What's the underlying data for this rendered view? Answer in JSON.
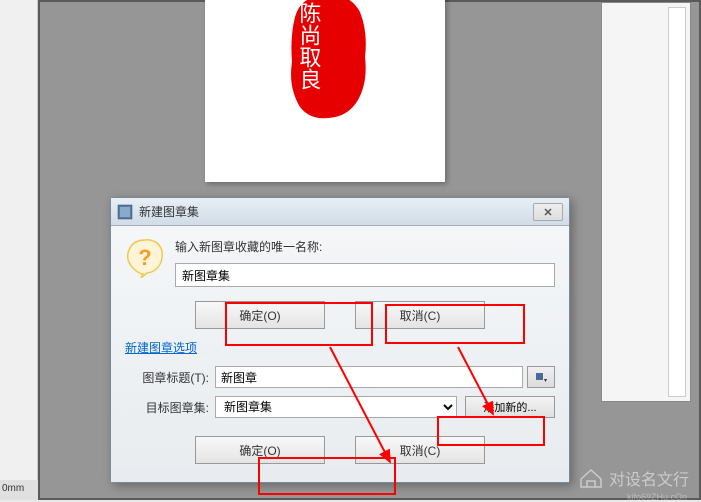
{
  "status": {
    "value": "0mm"
  },
  "dialog": {
    "title": "新建图章集",
    "prompt": "输入新图章收藏的唯一名称:",
    "name_value": "新图章集",
    "ok": "确定(O)",
    "cancel": "取消(C)",
    "section_link": "新建图章选项",
    "title_label": "图章标题(T):",
    "title_value": "新图章",
    "target_label": "目标图章集:",
    "target_value": "新图章集",
    "add_new": "添加新的...",
    "ok2": "确定(O)",
    "cancel2": "取消(C)"
  },
  "watermark": {
    "main": "对设名文行",
    "sub": "kifo69ZHu.cOn"
  },
  "seal": {
    "chars": "陈尚取良"
  },
  "canvas": {
    "left": "",
    "right": ""
  }
}
